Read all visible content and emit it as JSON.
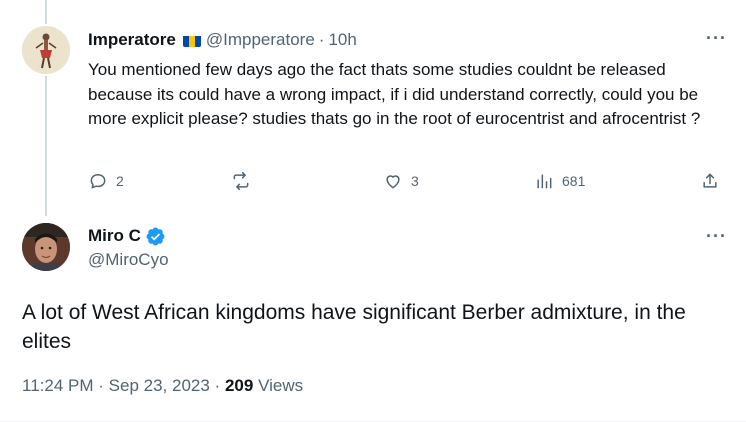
{
  "reply": {
    "name": "Imperatore",
    "handle": "@Impperatore",
    "separator": "·",
    "time": "10h",
    "more": "···",
    "text": "You mentioned few days ago the fact thats some studies couldnt be released because its could have a wrong impact, if i did understand correctly, could you be more explicit please? studies thats go in the root of eurocentrist and afrocentrist ?",
    "actions": {
      "reply_count": "2",
      "repost_count": "",
      "like_count": "3",
      "views_count": "681"
    }
  },
  "main": {
    "name": "Miro C",
    "handle": "@MiroCyo",
    "more": "···",
    "text": "A lot of West African kingdoms have significant Berber admixture, in the elites",
    "time": "11:24 PM",
    "date": "Sep 23, 2023",
    "separator1": "·",
    "separator2": "·",
    "views_count": "209",
    "views_label": "Views"
  },
  "icons": {
    "reply": "comment-icon",
    "repost": "repost-icon",
    "like": "heart-icon",
    "views": "analytics-icon",
    "share": "share-icon",
    "verified": "verified-badge-icon",
    "flag": "flag-icon"
  },
  "colors": {
    "text_primary": "#0f1419",
    "text_secondary": "#536471",
    "verified_blue": "#1d9bf0",
    "thread_line": "#cfd9de"
  }
}
